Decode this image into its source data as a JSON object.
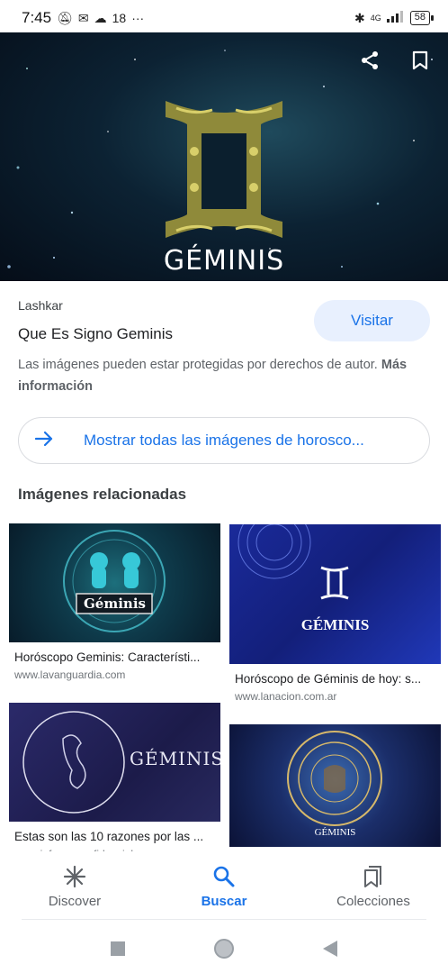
{
  "status_bar": {
    "time": "7:45",
    "temperature": "18",
    "more": "···",
    "network": "4G",
    "battery": "58"
  },
  "hero": {
    "title": "GÉMINIS",
    "share_icon": "share-icon",
    "bookmark_icon": "bookmark-icon"
  },
  "result": {
    "source": "Lashkar",
    "title": "Que Es Signo Geminis",
    "visit_label": "Visitar",
    "copyright_text": "Las imágenes pueden estar protegidas por derechos de autor.",
    "more_info": "Más información"
  },
  "show_all": {
    "label": "Mostrar todas las imágenes de horosco..."
  },
  "related": {
    "heading": "Imágenes relacionadas",
    "items": [
      {
        "caption": "Horóscopo Geminis: Característi...",
        "domain": "www.lavanguardia.com",
        "thumb_text": "Géminis"
      },
      {
        "caption": "Horóscopo de Géminis de hoy: s...",
        "domain": "www.lanacion.com.ar",
        "thumb_text": "GÉMINIS"
      },
      {
        "caption": "Estas son las 10 razones por las ...",
        "domain": "www.informeconfidencial.mx",
        "thumb_text": "GÉMINIS"
      },
      {
        "caption": "",
        "domain": "",
        "thumb_text": "GÉMINIS"
      }
    ]
  },
  "bottom_nav": {
    "items": [
      {
        "label": "Discover",
        "icon": "asterisk-icon"
      },
      {
        "label": "Buscar",
        "icon": "search-icon"
      },
      {
        "label": "Colecciones",
        "icon": "collections-icon"
      }
    ],
    "active": "Buscar"
  },
  "colors": {
    "accent": "#1a73e8",
    "visit_bg": "#e8f0fe",
    "hero_gold": "#b3a64a"
  }
}
